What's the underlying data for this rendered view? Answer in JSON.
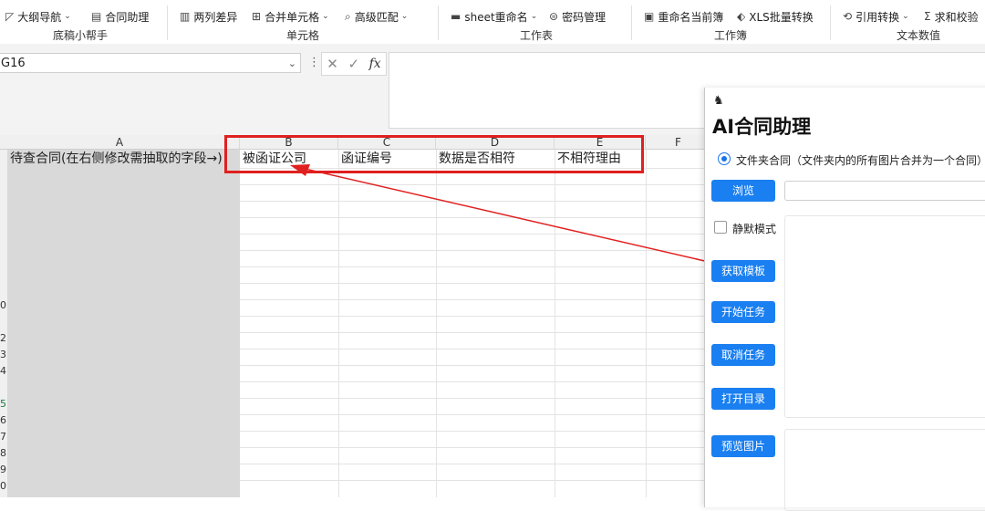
{
  "ribbon": {
    "buttons": [
      {
        "label": "大纲导航",
        "icon": "outline-nav-icon",
        "glyph": "◸",
        "chevron": true
      },
      {
        "label": "合同助理",
        "icon": "contract-doc-icon",
        "glyph": "▤",
        "chevron": false
      },
      {
        "label": "两列差异",
        "icon": "two-column-diff-icon",
        "glyph": "▥",
        "chevron": false
      },
      {
        "label": "合并单元格",
        "icon": "merge-cells-icon",
        "glyph": "⊞",
        "chevron": true
      },
      {
        "label": "高级匹配",
        "icon": "advanced-match-icon",
        "glyph": "⌕",
        "chevron": true
      },
      {
        "label": "sheet重命名",
        "icon": "sheet-rename-icon",
        "glyph": "▬",
        "chevron": true
      },
      {
        "label": "密码管理",
        "icon": "lock-icon",
        "glyph": "⊜",
        "chevron": false
      },
      {
        "label": "重命名当前簿",
        "icon": "rename-workbook-icon",
        "glyph": "▣",
        "chevron": false
      },
      {
        "label": "XLS批量转换",
        "icon": "batch-convert-icon",
        "glyph": "⬖",
        "chevron": false
      },
      {
        "label": "引用转换",
        "icon": "reference-convert-icon",
        "glyph": "⟲",
        "chevron": true
      },
      {
        "label": "求和校验",
        "icon": "sigma-icon",
        "glyph": "Σ",
        "chevron": false
      }
    ],
    "groups": [
      "底稿小帮手",
      "单元格",
      "工作表",
      "工作簿",
      "文本数值"
    ]
  },
  "formula_bar": {
    "name_box": "G16",
    "menu_glyph": "⋮",
    "cancel_glyph": "✕",
    "confirm_glyph": "✓",
    "fx_label": "fx",
    "content": ""
  },
  "sheet": {
    "columns": [
      "A",
      "B",
      "C",
      "D",
      "E",
      "F"
    ],
    "row_numbers": [
      "0",
      "2",
      "3",
      "4",
      "5",
      "6",
      "7",
      "8",
      "9",
      "0"
    ],
    "header_row": {
      "a": "待查合同(在右侧修改需抽取的字段→)",
      "b": "被函证公司",
      "c": "函证编号",
      "d": "数据是否相符",
      "e": "不相符理由"
    }
  },
  "panel": {
    "robot_glyph": "♞",
    "title": "AI合同助理",
    "radio_label": "文件夹合同（文件夹内的所有图片合并为一个合同）",
    "browse": "浏览",
    "silent_mode": "静默模式",
    "get_template": "获取模板",
    "start_task": "开始任务",
    "cancel_task": "取消任务",
    "open_dir": "打开目录",
    "preview_image": "预览图片"
  },
  "colors": {
    "accent": "#1a7ff0",
    "annotation": "#e02020"
  }
}
